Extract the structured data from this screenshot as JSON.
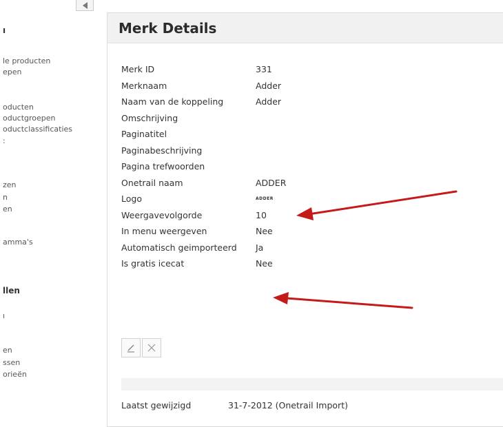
{
  "sidebar": {
    "items": [
      {
        "label": "ı",
        "bold": true
      },
      {
        "label": "le producten"
      },
      {
        "label": "epen"
      },
      {
        "label": "oducten"
      },
      {
        "label": "oductgroepen"
      },
      {
        "label": "oductclassificaties"
      },
      {
        "label": ":"
      },
      {
        "label": "zen"
      },
      {
        "label": "n"
      },
      {
        "label": "en"
      },
      {
        "label": "amma's"
      },
      {
        "label": "llen",
        "bold": true
      },
      {
        "label": "ı"
      },
      {
        "label": "en"
      },
      {
        "label": "ssen"
      },
      {
        "label": "orieën"
      }
    ]
  },
  "panel": {
    "title": "Merk Details"
  },
  "details": [
    {
      "label": "Merk ID",
      "value": "331"
    },
    {
      "label": "Merknaam",
      "value": "Adder"
    },
    {
      "label": "Naam van de koppeling",
      "value": "Adder"
    },
    {
      "label": "Omschrijving",
      "value": ""
    },
    {
      "label": "Paginatitel",
      "value": ""
    },
    {
      "label": "Paginabeschrijving",
      "value": ""
    },
    {
      "label": "Pagina trefwoorden",
      "value": ""
    },
    {
      "label": "Onetrail naam",
      "value": "ADDER"
    },
    {
      "label": "Logo",
      "value": "ADDER"
    },
    {
      "label": "Weergavevolgorde",
      "value": "10"
    },
    {
      "label": "In menu weergeven",
      "value": "Nee"
    },
    {
      "label": "Automatisch geimporteerd",
      "value": "Ja"
    },
    {
      "label": "Is gratis icecat",
      "value": "Nee"
    }
  ],
  "actions": {
    "edit_icon": "pencil-icon",
    "delete_icon": "close-icon"
  },
  "footer": {
    "modified_label": "Laatst gewijzigd",
    "modified_value": "31-7-2012 (Onetrail Import)"
  },
  "colors": {
    "arrow": "#c41a1a",
    "header_bg": "#f1f1f1"
  }
}
